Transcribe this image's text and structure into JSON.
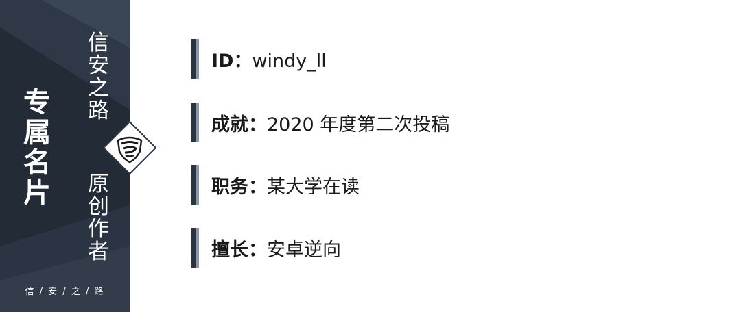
{
  "sidebar": {
    "title": [
      "专",
      "属",
      "名",
      "片"
    ],
    "subtitle_top": [
      "信",
      "安",
      "之",
      "路"
    ],
    "subtitle_bottom": [
      "原",
      "创",
      "作",
      "者"
    ],
    "footer_brand": "信 / 安 / 之 / 路",
    "colors": {
      "dark": "#232b37",
      "mid": "#2e3846",
      "light": "#3d4858"
    }
  },
  "badge": {
    "icon": "shield-logo-icon"
  },
  "profile": {
    "rows": [
      {
        "label": "ID：",
        "value": "windy_ll"
      },
      {
        "label": "成就：",
        "value": "2020 年度第二次投稿"
      },
      {
        "label": "职务：",
        "value": "某大学在读"
      },
      {
        "label": "擅长：",
        "value": "安卓逆向"
      }
    ]
  },
  "accent_colors": {
    "bar_dark": "#2b3542",
    "bar_light": "#8b96a6"
  }
}
